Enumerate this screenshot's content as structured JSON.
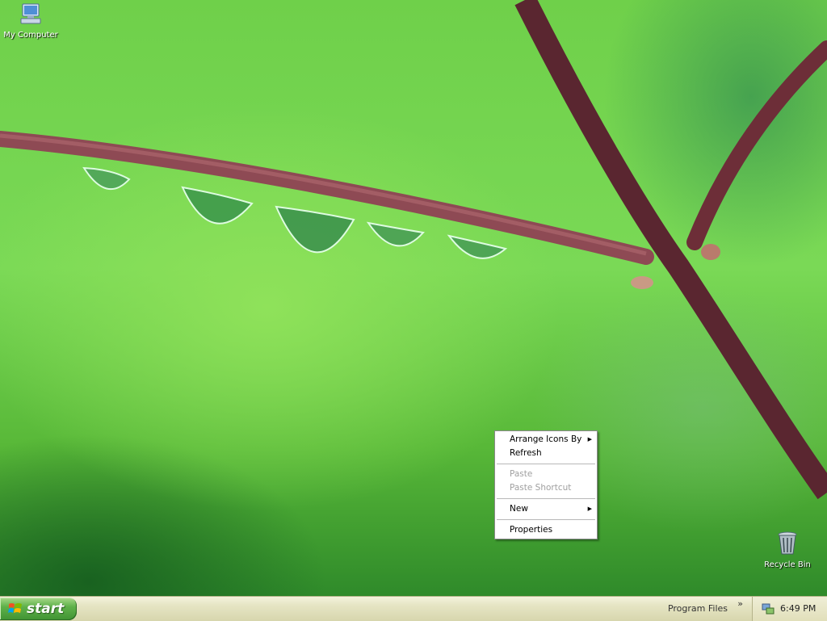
{
  "desktop": {
    "icons": [
      {
        "id": "my-computer",
        "label": "My Computer",
        "icon": "computer-icon"
      },
      {
        "id": "recycle-bin",
        "label": "Recycle Bin",
        "icon": "recycle-bin-icon"
      }
    ]
  },
  "context_menu": {
    "items": [
      {
        "label": "Arrange Icons By",
        "enabled": true,
        "submenu": true
      },
      {
        "label": "Refresh",
        "enabled": true,
        "submenu": false
      },
      {
        "label": "Paste",
        "enabled": false,
        "submenu": false
      },
      {
        "label": "Paste Shortcut",
        "enabled": false,
        "submenu": false
      },
      {
        "label": "New",
        "enabled": true,
        "submenu": true
      },
      {
        "label": "Properties",
        "enabled": true,
        "submenu": false
      }
    ]
  },
  "taskbar": {
    "start_label": "start",
    "toolbar_label": "Program Files",
    "chevron": "»",
    "tray_icon": "network-icon",
    "clock": "6:49 PM"
  },
  "colors": {
    "accent_green": "#3f9333",
    "taskbar": "#e6e5c4",
    "wallpaper_green": "#7ad956",
    "disabled_text": "#a0a0a0"
  }
}
